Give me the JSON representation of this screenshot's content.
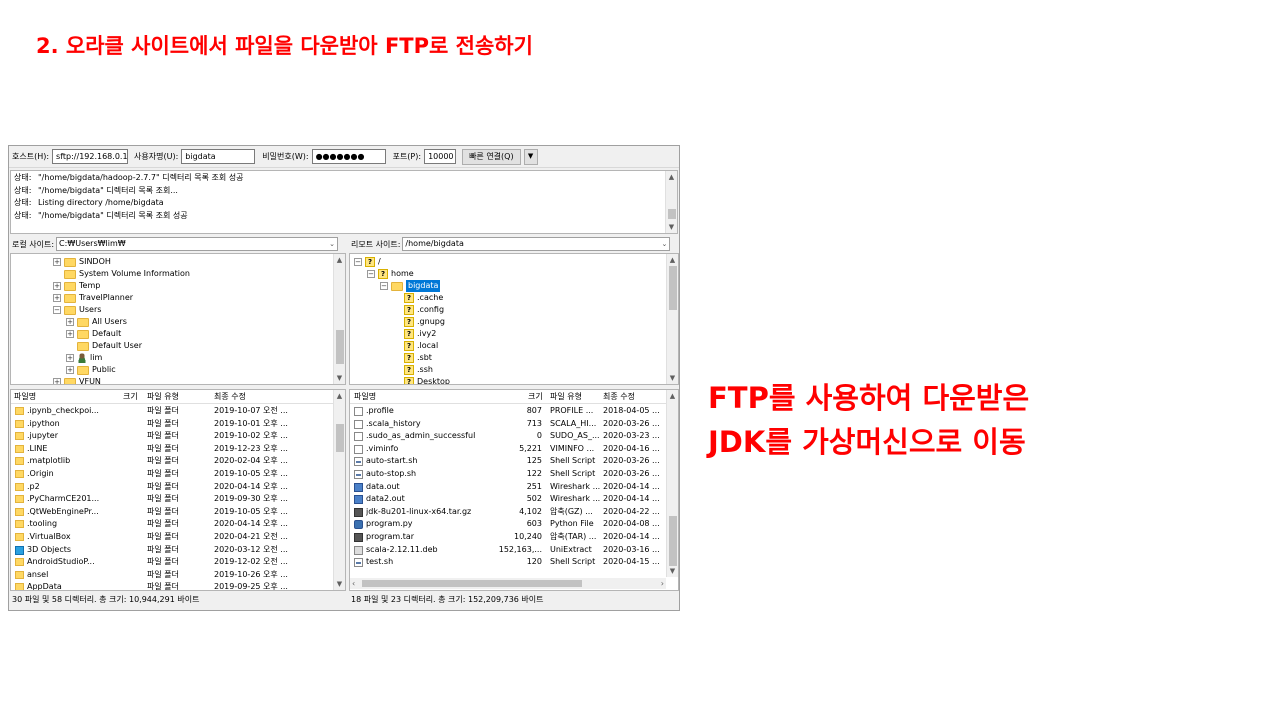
{
  "slide": {
    "title": "2. 오라클 사이트에서 파일을 다운받아 FTP로 전송하기",
    "callout_line1": "FTP를 사용하여 다운받은",
    "callout_line2": "JDK를 가상머신으로 이동"
  },
  "quickconnect": {
    "host_label": "호스트(H):",
    "host_value": "sftp://192.168.0.1",
    "user_label": "사용자명(U):",
    "user_value": "bigdata",
    "password_label": "비밀번호(W):",
    "password_value": "●●●●●●●",
    "port_label": "포트(P):",
    "port_value": "10000",
    "connect_button": "빠른 연결(Q)",
    "dropdown_icon": "▼"
  },
  "log": [
    {
      "k": "상태:",
      "v": "\"/home/bigdata/hadoop-2.7.7\" 디렉터리 목록 조회 성공"
    },
    {
      "k": "상태:",
      "v": "\"/home/bigdata\" 디렉터리 목록 조회..."
    },
    {
      "k": "상태:",
      "v": "Listing directory /home/bigdata"
    },
    {
      "k": "상태:",
      "v": "\"/home/bigdata\" 디렉터리 목록 조회 성공"
    }
  ],
  "local": {
    "site_label": "로컬 사이트:",
    "site_value": "C:₩Users₩lim₩",
    "tree": [
      {
        "label": "SINDOH",
        "level": 0,
        "exp": "+",
        "icon": "folder"
      },
      {
        "label": "System Volume Information",
        "level": 0,
        "exp": "",
        "icon": "folder"
      },
      {
        "label": "Temp",
        "level": 0,
        "exp": "+",
        "icon": "folder"
      },
      {
        "label": "TravelPlanner",
        "level": 0,
        "exp": "+",
        "icon": "folder"
      },
      {
        "label": "Users",
        "level": 0,
        "exp": "-",
        "icon": "folder"
      },
      {
        "label": "All Users",
        "level": 1,
        "exp": "+",
        "icon": "folder"
      },
      {
        "label": "Default",
        "level": 1,
        "exp": "+",
        "icon": "folder"
      },
      {
        "label": "Default User",
        "level": 1,
        "exp": "",
        "icon": "folder"
      },
      {
        "label": "lim",
        "level": 1,
        "exp": "+",
        "icon": "user"
      },
      {
        "label": "Public",
        "level": 1,
        "exp": "+",
        "icon": "folder"
      },
      {
        "label": "VFUN",
        "level": 0,
        "exp": "+",
        "icon": "folder"
      }
    ],
    "columns": {
      "name": "파일명",
      "size": "크기",
      "type": "파일 유형",
      "modified": "최종 수정"
    },
    "files": [
      {
        "name": ".ipynb_checkpoi...",
        "size": "",
        "type": "파일 폴더",
        "modified": "2019-10-07 오전 ...",
        "icon": "folder"
      },
      {
        "name": ".ipython",
        "size": "",
        "type": "파일 폴더",
        "modified": "2019-10-01 오후 ...",
        "icon": "folder"
      },
      {
        "name": ".jupyter",
        "size": "",
        "type": "파일 폴더",
        "modified": "2019-10-02 오후 ...",
        "icon": "folder"
      },
      {
        "name": ".LINE",
        "size": "",
        "type": "파일 폴더",
        "modified": "2019-12-23 오후 ...",
        "icon": "folder"
      },
      {
        "name": ".matplotlib",
        "size": "",
        "type": "파일 폴더",
        "modified": "2020-02-04 오후 ...",
        "icon": "folder"
      },
      {
        "name": ".Origin",
        "size": "",
        "type": "파일 폴더",
        "modified": "2019-10-05 오후 ...",
        "icon": "folder"
      },
      {
        "name": ".p2",
        "size": "",
        "type": "파일 폴더",
        "modified": "2020-04-14 오후 ...",
        "icon": "folder"
      },
      {
        "name": ".PyCharmCE201...",
        "size": "",
        "type": "파일 폴더",
        "modified": "2019-09-30 오후 ...",
        "icon": "folder"
      },
      {
        "name": ".QtWebEnginePr...",
        "size": "",
        "type": "파일 폴더",
        "modified": "2019-10-05 오후 ...",
        "icon": "folder"
      },
      {
        "name": ".tooling",
        "size": "",
        "type": "파일 폴더",
        "modified": "2020-04-14 오후 ...",
        "icon": "folder"
      },
      {
        "name": ".VirtualBox",
        "size": "",
        "type": "파일 폴더",
        "modified": "2020-04-21 오전 ...",
        "icon": "folder"
      },
      {
        "name": "3D Objects",
        "size": "",
        "type": "파일 폴더",
        "modified": "2020-03-12 오전 ...",
        "icon": "box3d"
      },
      {
        "name": "AndroidStudioP...",
        "size": "",
        "type": "파일 폴더",
        "modified": "2019-12-02 오전 ...",
        "icon": "folder"
      },
      {
        "name": "ansel",
        "size": "",
        "type": "파일 폴더",
        "modified": "2019-10-26 오후 ...",
        "icon": "folder"
      },
      {
        "name": "AppData",
        "size": "",
        "type": "파일 폴더",
        "modified": "2019-09-25 오후 ...",
        "icon": "folder"
      }
    ],
    "status": "30 파일 및 58 디렉터리. 총 크기: 10,944,291 바이트"
  },
  "remote": {
    "site_label": "리모트 사이트:",
    "site_value": "/home/bigdata",
    "tree": [
      {
        "label": "/",
        "level": 0,
        "exp": "-",
        "icon": "q"
      },
      {
        "label": "home",
        "level": 1,
        "exp": "-",
        "icon": "q"
      },
      {
        "label": "bigdata",
        "level": 2,
        "exp": "-",
        "icon": "folder",
        "selected": true
      },
      {
        "label": ".cache",
        "level": 3,
        "exp": "",
        "icon": "q"
      },
      {
        "label": ".config",
        "level": 3,
        "exp": "",
        "icon": "q"
      },
      {
        "label": ".gnupg",
        "level": 3,
        "exp": "",
        "icon": "q"
      },
      {
        "label": ".ivy2",
        "level": 3,
        "exp": "",
        "icon": "q"
      },
      {
        "label": ".local",
        "level": 3,
        "exp": "",
        "icon": "q"
      },
      {
        "label": ".sbt",
        "level": 3,
        "exp": "",
        "icon": "q"
      },
      {
        "label": ".ssh",
        "level": 3,
        "exp": "",
        "icon": "q"
      },
      {
        "label": "Desktop",
        "level": 3,
        "exp": "",
        "icon": "q"
      }
    ],
    "columns": {
      "name": "파일명",
      "size": "크기",
      "type": "파일 유형",
      "modified": "최종 수정"
    },
    "files": [
      {
        "name": ".profile",
        "size": "807",
        "type": "PROFILE ...",
        "modified": "2018-04-05 ...",
        "icon": "file"
      },
      {
        "name": ".scala_history",
        "size": "713",
        "type": "SCALA_HI...",
        "modified": "2020-03-26 ...",
        "icon": "file"
      },
      {
        "name": ".sudo_as_admin_successful",
        "size": "0",
        "type": "SUDO_AS_...",
        "modified": "2020-03-23 ...",
        "icon": "file"
      },
      {
        "name": ".viminfo",
        "size": "5,221",
        "type": "VIMINFO ...",
        "modified": "2020-04-16 ...",
        "icon": "file"
      },
      {
        "name": "auto-start.sh",
        "size": "125",
        "type": "Shell Script",
        "modified": "2020-03-26 ...",
        "icon": "sh"
      },
      {
        "name": "auto-stop.sh",
        "size": "122",
        "type": "Shell Script",
        "modified": "2020-03-26 ...",
        "icon": "sh"
      },
      {
        "name": "data.out",
        "size": "251",
        "type": "Wireshark ...",
        "modified": "2020-04-14 ...",
        "icon": "ws"
      },
      {
        "name": "data2.out",
        "size": "502",
        "type": "Wireshark ...",
        "modified": "2020-04-14 ...",
        "icon": "ws"
      },
      {
        "name": "jdk-8u201-linux-x64.tar.gz",
        "size": "4,102",
        "type": "압축(GZ) ...",
        "modified": "2020-04-22 ...",
        "icon": "gz"
      },
      {
        "name": "program.py",
        "size": "603",
        "type": "Python File",
        "modified": "2020-04-08 ...",
        "icon": "py"
      },
      {
        "name": "program.tar",
        "size": "10,240",
        "type": "압축(TAR) ...",
        "modified": "2020-04-14 ...",
        "icon": "gz"
      },
      {
        "name": "scala-2.12.11.deb",
        "size": "152,163,...",
        "type": "UniExtract",
        "modified": "2020-03-16 ...",
        "icon": "ue"
      },
      {
        "name": "test.sh",
        "size": "120",
        "type": "Shell Script",
        "modified": "2020-04-15 ...",
        "icon": "sh"
      }
    ],
    "status": "18 파일 및 23 디렉터리. 총 크기: 152,209,736 바이트"
  }
}
